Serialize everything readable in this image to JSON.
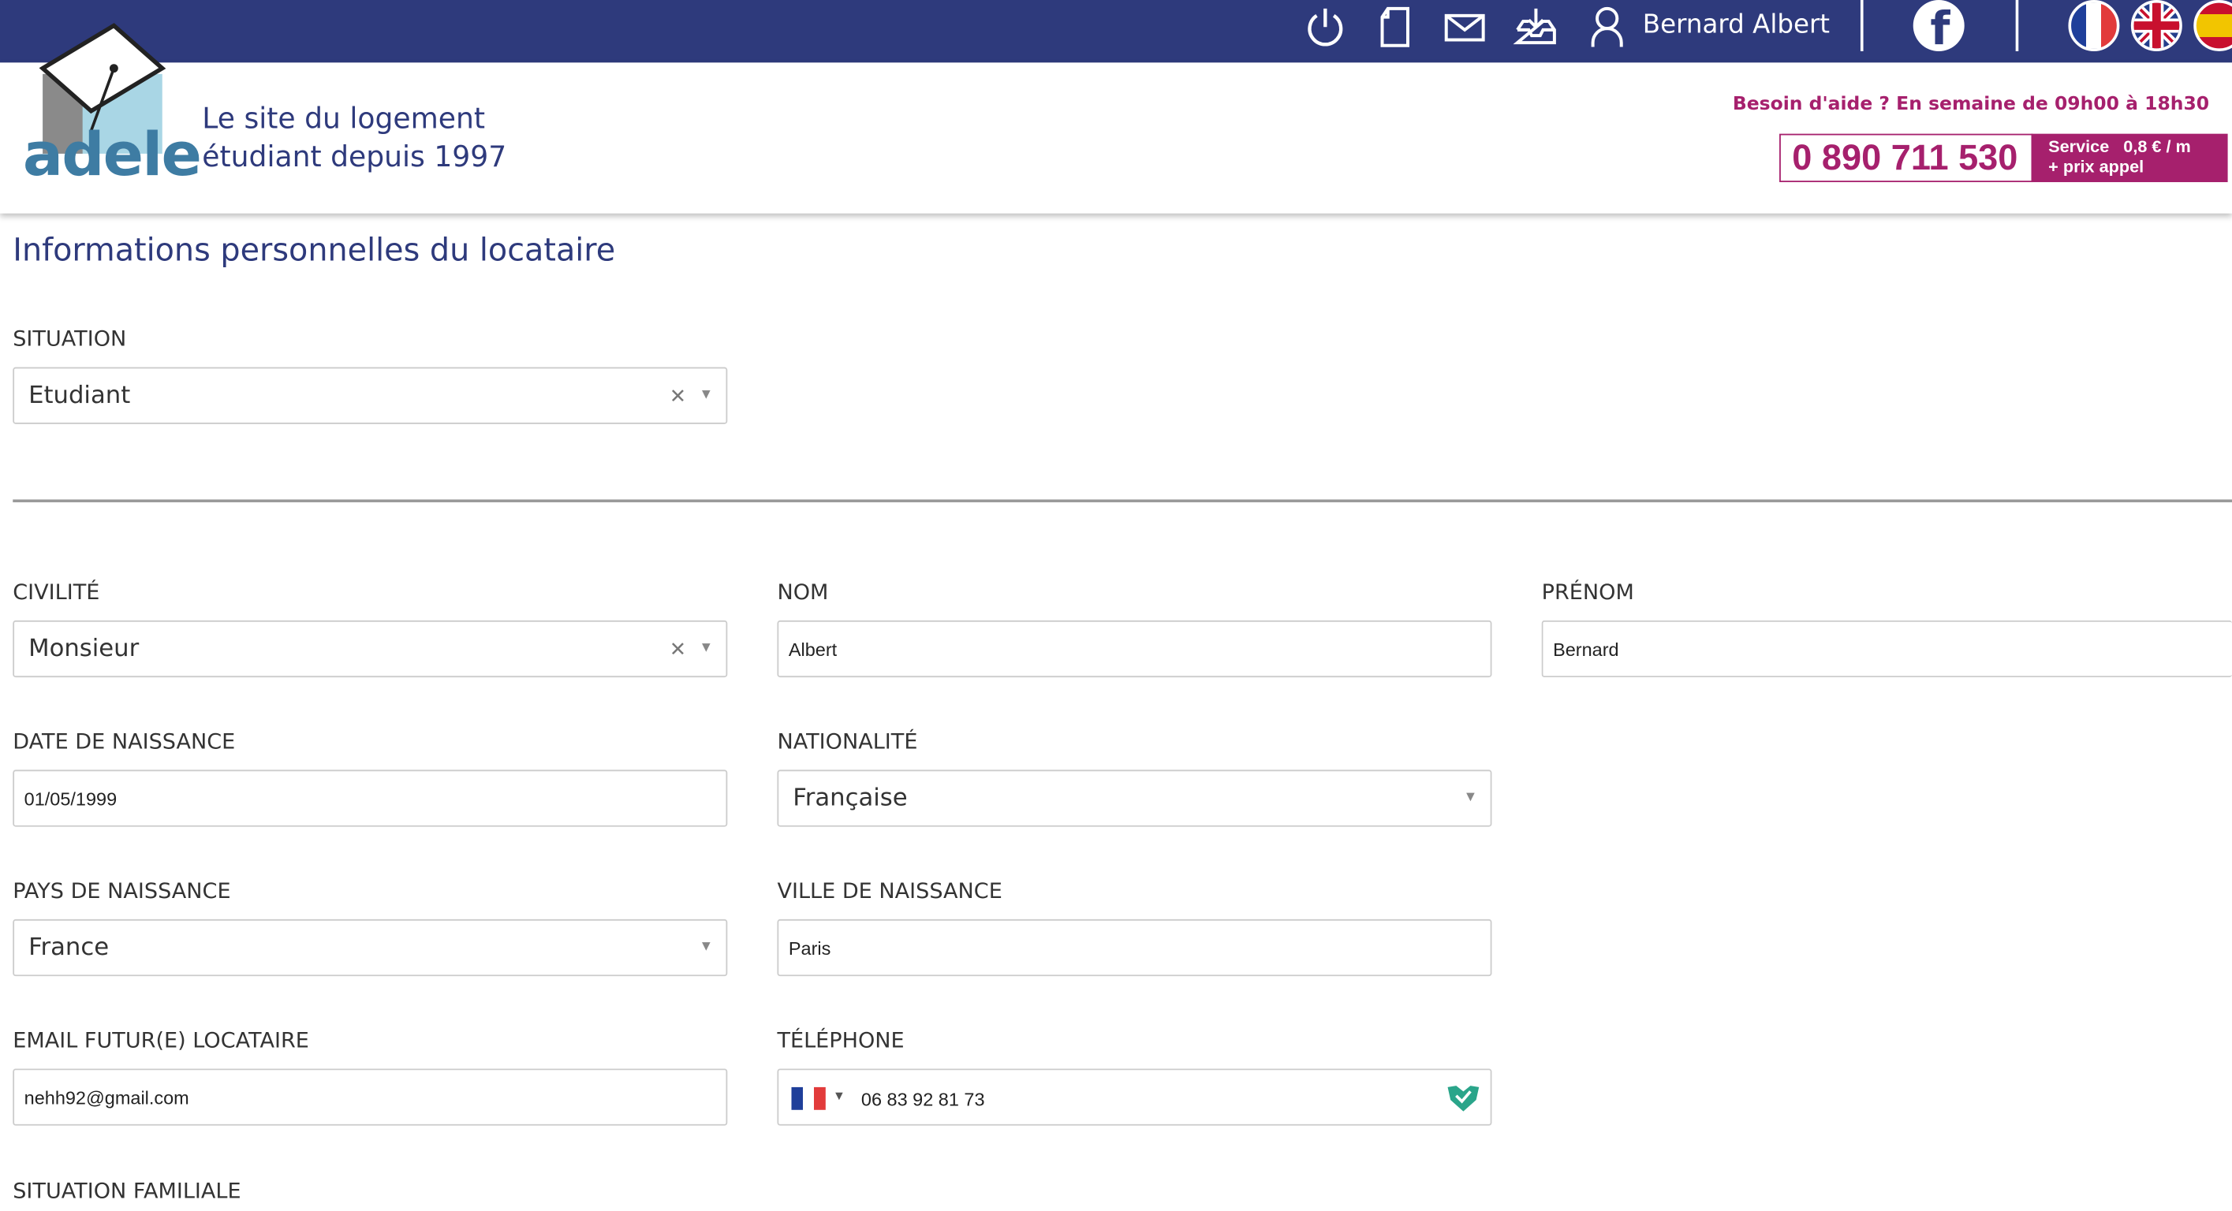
{
  "topbar": {
    "user_name": "Bernard Albert",
    "icons": [
      "power-icon",
      "document-icon",
      "mail-icon",
      "inbox-download-icon",
      "user-icon"
    ],
    "languages": [
      "fr",
      "en",
      "es"
    ]
  },
  "header": {
    "logo_text": "adele",
    "tagline_line1": "Le site du logement",
    "tagline_line2": "étudiant depuis 1997",
    "help_text": "Besoin d'aide ? En semaine de 09h00 à 18h30",
    "phone": "0 890 711 530",
    "phone_tag_line1": "Service   0,8 € / m",
    "phone_tag_line2": "+ prix appel",
    "brand_color": "#2e3a7c",
    "accent_color": "#a6206d"
  },
  "form": {
    "title": "Informations personnelles du locataire",
    "situation": {
      "label": "SITUATION",
      "value": "Etudiant"
    },
    "civilite": {
      "label": "CIVILITÉ",
      "value": "Monsieur"
    },
    "nom": {
      "label": "NOM",
      "value": "Albert"
    },
    "prenom": {
      "label": "PRÉNOM",
      "value": "Bernard"
    },
    "date_naissance": {
      "label": "DATE DE NAISSANCE",
      "value": "01/05/1999"
    },
    "nationalite": {
      "label": "NATIONALITÉ",
      "value": "Française"
    },
    "pays_naissance": {
      "label": "PAYS DE NAISSANCE",
      "value": "France"
    },
    "ville_naissance": {
      "label": "VILLE DE NAISSANCE",
      "value": "Paris"
    },
    "email": {
      "label": "EMAIL FUTUR(E) LOCATAIRE",
      "value": "nehh92@gmail.com"
    },
    "telephone": {
      "label": "TÉLÉPHONE",
      "value": "06 83 92 81 73",
      "country": "fr"
    },
    "situation_familiale": {
      "label": "SITUATION FAMILIALE"
    }
  }
}
